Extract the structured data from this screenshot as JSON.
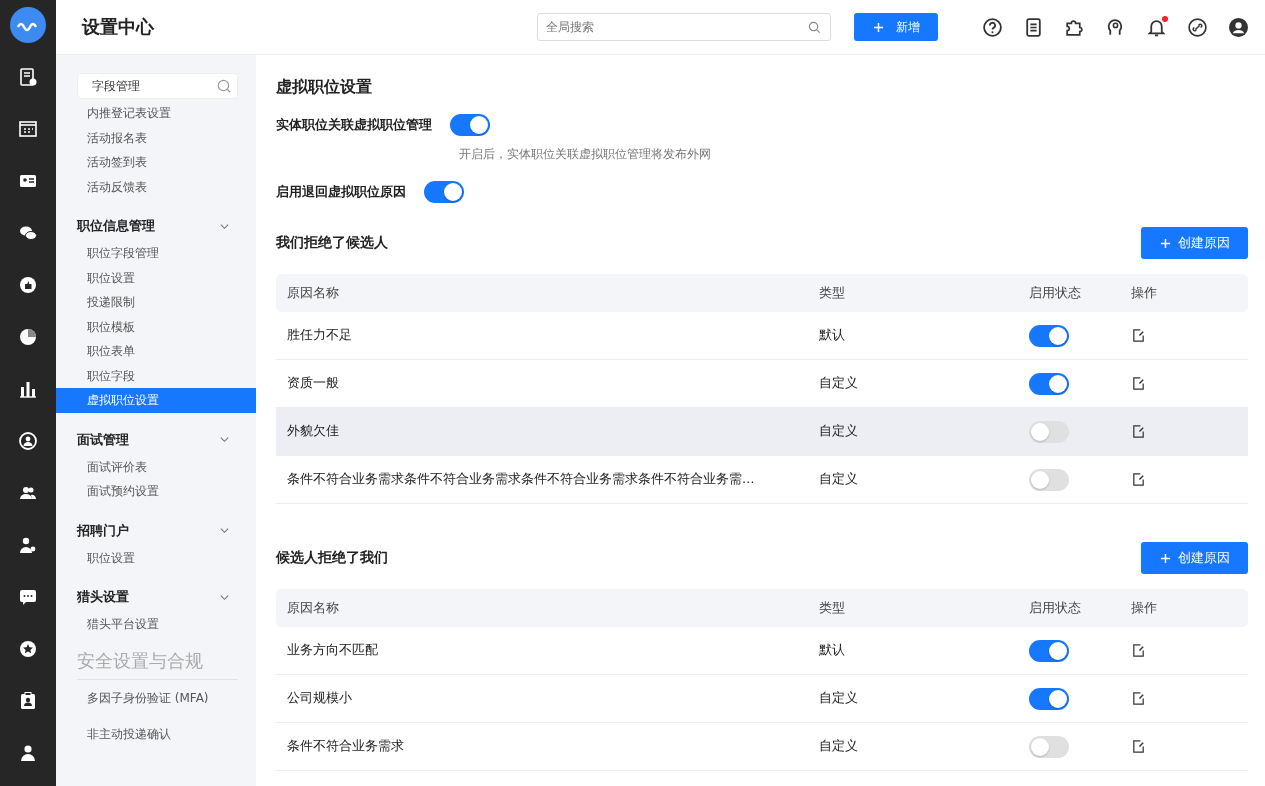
{
  "header": {
    "title": "设置中心",
    "search": {
      "placeholder": "全局搜索"
    },
    "new_button": "新增",
    "notification_dot": true
  },
  "sidebar": {
    "search": {
      "value": "字段管理"
    },
    "groups": [
      {
        "items": [
          {
            "label": "内推登记表设置",
            "selected": false
          },
          {
            "label": "活动报名表",
            "selected": false
          },
          {
            "label": "活动签到表",
            "selected": false
          },
          {
            "label": "活动反馈表",
            "selected": false
          }
        ]
      },
      {
        "title": "职位信息管理",
        "expanded": true,
        "items": [
          {
            "label": "职位字段管理",
            "selected": false
          },
          {
            "label": "职位设置",
            "selected": false
          },
          {
            "label": "投递限制",
            "selected": false
          },
          {
            "label": "职位模板",
            "selected": false
          },
          {
            "label": "职位表单",
            "selected": false
          },
          {
            "label": "职位字段",
            "selected": false
          },
          {
            "label": "虚拟职位设置",
            "selected": true
          }
        ]
      },
      {
        "title": "面试管理",
        "expanded": true,
        "items": [
          {
            "label": "面试评价表",
            "selected": false
          },
          {
            "label": "面试预约设置",
            "selected": false
          }
        ]
      },
      {
        "title": "招聘门户",
        "expanded": true,
        "items": [
          {
            "label": "职位设置",
            "selected": false
          }
        ]
      },
      {
        "title": "猎头设置",
        "expanded": true,
        "items": [
          {
            "label": "猎头平台设置",
            "selected": false
          }
        ]
      }
    ],
    "section": {
      "title": "安全设置与合规",
      "items": [
        {
          "label": "多因子身份验证 (MFA)",
          "selected": false
        },
        {
          "label": "非主动投递确认",
          "selected": false
        }
      ]
    }
  },
  "page": {
    "title": "虚拟职位设置",
    "settings": [
      {
        "label": "实体职位关联虚拟职位管理",
        "on": true,
        "hint": "开启后，实体职位关联虚拟职位管理将发布外网"
      },
      {
        "label": "启用退回虚拟职位原因",
        "on": true
      }
    ],
    "tables": [
      {
        "title": "我们拒绝了候选人",
        "button": "创建原因",
        "columns": [
          "原因名称",
          "类型",
          "启用状态",
          "操作"
        ],
        "rows": [
          {
            "name": "胜任力不足",
            "type": "默认",
            "on": true,
            "highlighted": false
          },
          {
            "name": "资质一般",
            "type": "自定义",
            "on": true,
            "highlighted": false
          },
          {
            "name": "外貌欠佳",
            "type": "自定义",
            "on": false,
            "highlighted": true
          },
          {
            "name": "条件不符合业务需求条件不符合业务需求条件不符合业务需求条件不符合业务需…",
            "type": "自定义",
            "on": false,
            "highlighted": false
          }
        ]
      },
      {
        "title": "候选人拒绝了我们",
        "button": "创建原因",
        "columns": [
          "原因名称",
          "类型",
          "启用状态",
          "操作"
        ],
        "rows": [
          {
            "name": "业务方向不匹配",
            "type": "默认",
            "on": true,
            "highlighted": false
          },
          {
            "name": "公司规模小",
            "type": "自定义",
            "on": true,
            "highlighted": false
          },
          {
            "name": "条件不符合业务需求",
            "type": "自定义",
            "on": false,
            "highlighted": false
          }
        ]
      }
    ]
  }
}
